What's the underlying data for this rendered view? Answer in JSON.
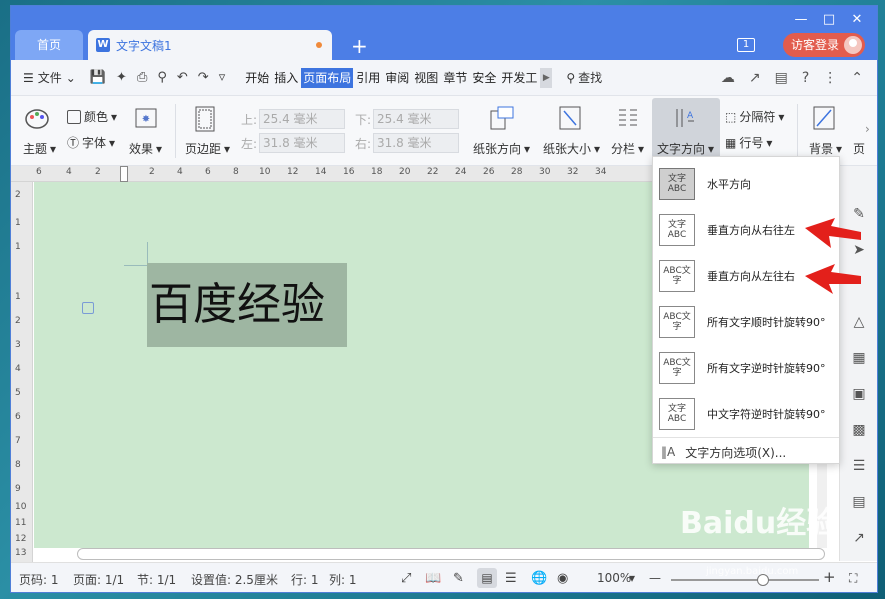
{
  "titlebar": {
    "home_tab": "首页",
    "doc_tab": "文字文稿1",
    "badge": "1",
    "login_btn": "访客登录"
  },
  "menubar": {
    "file": "文件",
    "tabs": [
      "开始",
      "插入",
      "页面布局",
      "引用",
      "审阅",
      "视图",
      "章节",
      "安全",
      "开发工"
    ],
    "active_tab": "页面布局",
    "search": "查找"
  },
  "ribbon": {
    "theme": "主题",
    "color": "颜色",
    "font": "字体",
    "effect": "效果",
    "margin": "页边距",
    "top_label": "上:",
    "top_value": "25.4 毫米",
    "bottom_label": "下:",
    "bottom_value": "25.4 毫米",
    "left_label": "左:",
    "left_value": "31.8 毫米",
    "right_label": "右:",
    "right_value": "31.8 毫米",
    "orientation": "纸张方向",
    "size": "纸张大小",
    "columns": "分栏",
    "text_direction": "文字方向",
    "separator": "分隔符",
    "line_number": "行号",
    "background": "背景",
    "page": "页"
  },
  "ruler": {
    "top": [
      "6",
      "4",
      "2",
      "2",
      "4",
      "6",
      "8",
      "10",
      "12",
      "14",
      "16",
      "18",
      "20",
      "22",
      "24",
      "26",
      "28",
      "30",
      "32",
      "34"
    ],
    "left": [
      "2",
      "1",
      "1",
      "1",
      "2",
      "3",
      "4",
      "5",
      "6",
      "7",
      "8",
      "9",
      "10",
      "11",
      "12",
      "13"
    ]
  },
  "document": {
    "text": "百度经验"
  },
  "dropdown": {
    "items": [
      {
        "label": "水平方向",
        "icon_text": "文字ABC"
      },
      {
        "label": "垂直方向从右往左",
        "icon_text": "文字ABC"
      },
      {
        "label": "垂直方向从左往右",
        "icon_text": "ABC文字"
      },
      {
        "label": "所有文字顺时针旋转90°",
        "icon_text": "ABC文字"
      },
      {
        "label": "所有文字逆时针旋转90°",
        "icon_text": "ABC文字"
      },
      {
        "label": "中文字符逆时针旋转90°",
        "icon_text": "文字ABC"
      }
    ],
    "options": "文字方向选项(X)..."
  },
  "statusbar": {
    "page_num": "页码: 1",
    "pages": "页面: 1/1",
    "section": "节: 1/1",
    "setting": "设置值: 2.5厘米",
    "row": "行: 1",
    "col": "列: 1",
    "zoom": "100%",
    "zoom_level": 0.62
  },
  "watermark": {
    "text": "Baidu经验",
    "sub": "jingyan.baidu.com"
  },
  "colors": {
    "titlebar": "#4c7ee6",
    "accent": "#3d74df",
    "doc_bg": "#cce8cf",
    "login": "#e25c4d",
    "arrow": "#e3201b"
  }
}
